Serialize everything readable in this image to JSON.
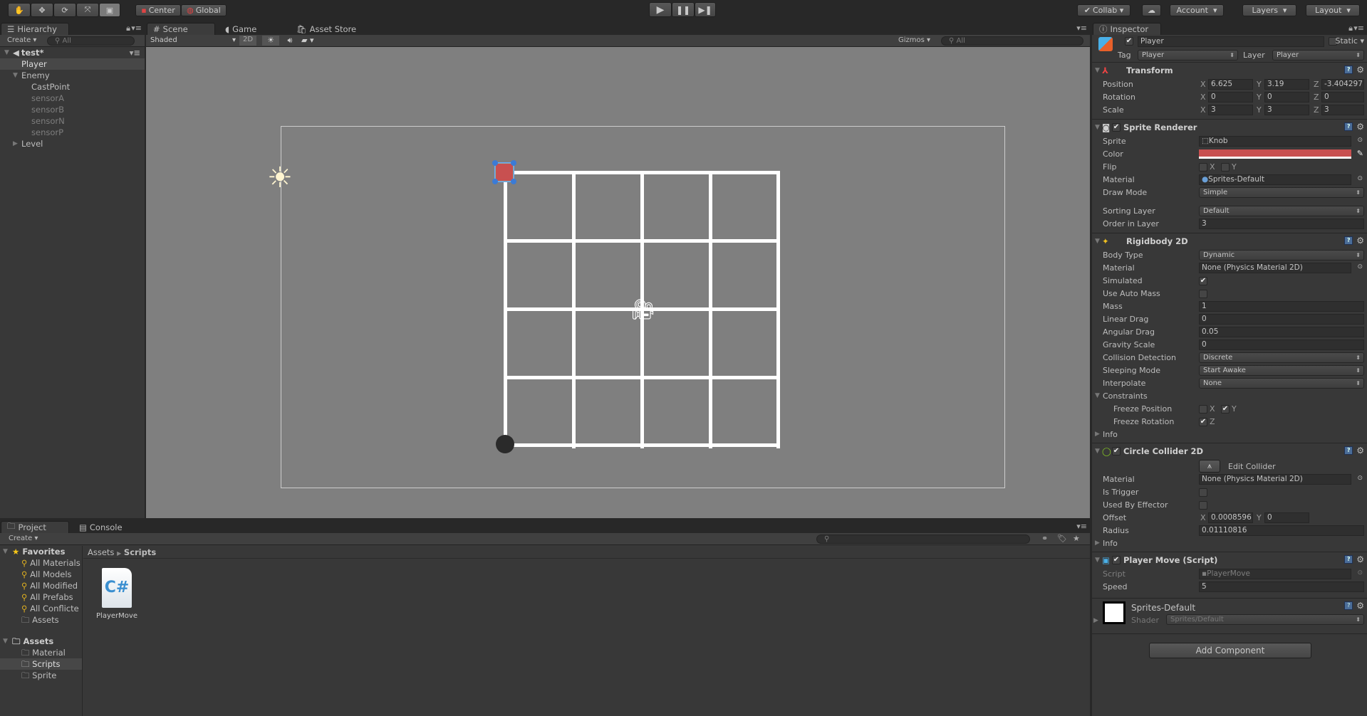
{
  "toolbar": {
    "tools": [
      "hand-tool",
      "move-tool",
      "rotate-tool",
      "scale-tool",
      "rect-tool"
    ],
    "pivot": "Center",
    "space": "Global",
    "collab": "Collab",
    "account": "Account",
    "layers": "Layers",
    "layout": "Layout"
  },
  "hierarchy": {
    "tab": "Hierarchy",
    "create": "Create",
    "search_placeholder": "All",
    "scene": "test*",
    "items": [
      {
        "label": "Player",
        "indent": 1,
        "selected": true,
        "dim": false
      },
      {
        "label": "Enemy",
        "indent": 1,
        "expanded": true,
        "dim": false
      },
      {
        "label": "CastPoint",
        "indent": 2,
        "dim": false
      },
      {
        "label": "sensorA",
        "indent": 2,
        "dim": true
      },
      {
        "label": "sensorB",
        "indent": 2,
        "dim": true
      },
      {
        "label": "sensorN",
        "indent": 2,
        "dim": true
      },
      {
        "label": "sensorP",
        "indent": 2,
        "dim": true
      },
      {
        "label": "Level",
        "indent": 1,
        "collapsed": true,
        "dim": false
      }
    ]
  },
  "scene": {
    "tabs": [
      "Scene",
      "Game",
      "Asset Store"
    ],
    "shading": "Shaded",
    "mode_2d": "2D",
    "gizmos": "Gizmos",
    "search_placeholder": "All",
    "sprite_color": "#c85050"
  },
  "project": {
    "tabs": [
      "Project",
      "Console"
    ],
    "create": "Create",
    "favorites": "Favorites",
    "favorite_items": [
      "All Materials",
      "All Models",
      "All Modified",
      "All Prefabs",
      "All Conflicte",
      "Assets"
    ],
    "assets": "Assets",
    "asset_folders": [
      "Material",
      "Scripts",
      "Sprite"
    ],
    "selected_folder": "Scripts",
    "breadcrumb": [
      "Assets",
      "Scripts"
    ],
    "files": [
      {
        "name": "PlayerMove",
        "icon": "csharp-script-icon"
      }
    ]
  },
  "inspector": {
    "tab": "Inspector",
    "name": "Player",
    "static": "Static",
    "tag_label": "Tag",
    "tag": "Player",
    "layer_label": "Layer",
    "layer": "Player",
    "transform": {
      "title": "Transform",
      "rows": [
        {
          "label": "Position",
          "x": "6.625",
          "y": "3.19",
          "z": "-3.404297"
        },
        {
          "label": "Rotation",
          "x": "0",
          "y": "0",
          "z": "0"
        },
        {
          "label": "Scale",
          "x": "3",
          "y": "3",
          "z": "3"
        }
      ]
    },
    "sprite_renderer": {
      "title": "Sprite Renderer",
      "sprite_label": "Sprite",
      "sprite": "Knob",
      "color_label": "Color",
      "color": "#c85050",
      "flip_label": "Flip",
      "flip_x": false,
      "flip_y": false,
      "material_label": "Material",
      "material": "Sprites-Default",
      "draw_mode_label": "Draw Mode",
      "draw_mode": "Simple",
      "sorting_layer_label": "Sorting Layer",
      "sorting_layer": "Default",
      "order_label": "Order in Layer",
      "order": "3"
    },
    "rigidbody": {
      "title": "Rigidbody 2D",
      "body_type_label": "Body Type",
      "body_type": "Dynamic",
      "material_label": "Material",
      "material": "None (Physics Material 2D)",
      "simulated_label": "Simulated",
      "auto_mass_label": "Use Auto Mass",
      "mass_label": "Mass",
      "mass": "1",
      "linear_drag_label": "Linear Drag",
      "linear_drag": "0",
      "angular_drag_label": "Angular Drag",
      "angular_drag": "0.05",
      "gravity_label": "Gravity Scale",
      "gravity": "0",
      "collision_label": "Collision Detection",
      "collision": "Discrete",
      "sleeping_label": "Sleeping Mode",
      "sleeping": "Start Awake",
      "interpolate_label": "Interpolate",
      "interpolate": "None",
      "constraints_label": "Constraints",
      "freeze_pos_label": "Freeze Position",
      "freeze_rot_label": "Freeze Rotation",
      "info_label": "Info"
    },
    "circle_collider": {
      "title": "Circle Collider 2D",
      "edit_collider": "Edit Collider",
      "material_label": "Material",
      "material": "None (Physics Material 2D)",
      "trigger_label": "Is Trigger",
      "effector_label": "Used By Effector",
      "offset_label": "Offset",
      "offset_x": "0.0008596",
      "offset_y": "0",
      "radius_label": "Radius",
      "radius": "0.01110816",
      "info_label": "Info"
    },
    "player_move": {
      "title": "Player Move (Script)",
      "script_label": "Script",
      "script": "PlayerMove",
      "speed_label": "Speed",
      "speed": "5"
    },
    "material": {
      "name": "Sprites-Default",
      "shader_label": "Shader",
      "shader": "Sprites/Default"
    },
    "add_component": "Add Component",
    "axes": {
      "x": "X",
      "y": "Y",
      "z": "Z"
    }
  }
}
